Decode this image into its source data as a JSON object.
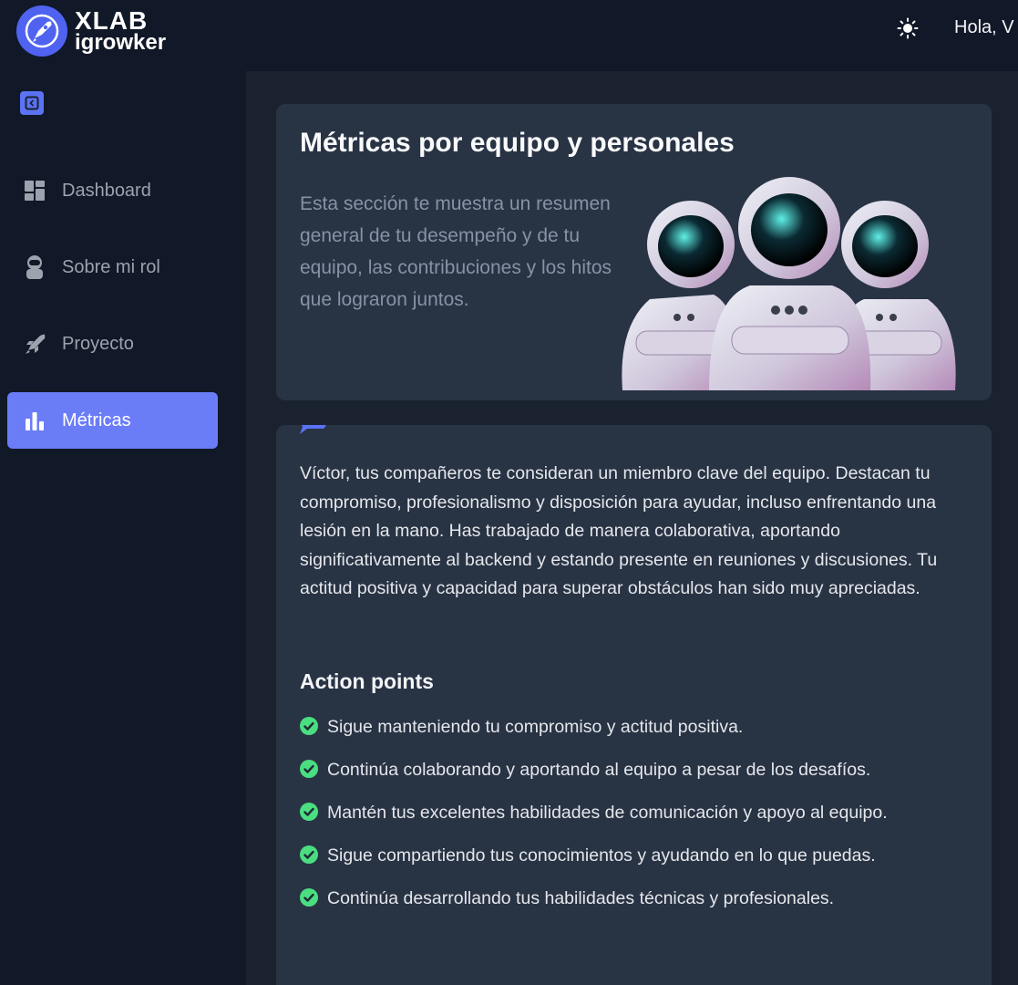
{
  "header": {
    "logo_line1": "XLAB",
    "logo_line2": "igrowker",
    "greeting": "Hola, V",
    "theme_icon": "sun-icon"
  },
  "sidebar": {
    "items": [
      {
        "label": "Dashboard",
        "icon": "dashboard-icon",
        "active": false
      },
      {
        "label": "Sobre mi rol",
        "icon": "astronaut-icon",
        "active": false
      },
      {
        "label": "Proyecto",
        "icon": "rocket-icon",
        "active": false
      },
      {
        "label": "Métricas",
        "icon": "bar-chart-icon",
        "active": true
      }
    ]
  },
  "hero": {
    "title": "Métricas por equipo y personales",
    "description": "Esta sección te muestra un resumen general de tu desempeño y de tu equipo, las contribuciones y los hitos que lograron juntos."
  },
  "feedback": {
    "text": "Víctor, tus compañeros te consideran un miembro clave del equipo. Destacan tu compromiso, profesionalismo y disposición para ayudar, incluso enfrentando una lesión en la mano. Has trabajado de manera colaborativa, aportando significativamente al backend y estando presente en reuniones y discusiones. Tu actitud positiva y capacidad para superar obstáculos han sido muy apreciadas.",
    "action_points_title": "Action points",
    "action_points": [
      "Sigue manteniendo tu compromiso y actitud positiva.",
      "Continúa colaborando y aportando al equipo a pesar de los desafíos.",
      "Mantén tus excelentes habilidades de comunicación y apoyo al equipo.",
      "Sigue compartiendo tus conocimientos y ayudando en lo que puedas.",
      "Continúa desarrollando tus habilidades técnicas y profesionales."
    ]
  },
  "colors": {
    "accent": "#6b7cf7",
    "check": "#4ade80",
    "card": "#283344",
    "background": "#111827"
  }
}
